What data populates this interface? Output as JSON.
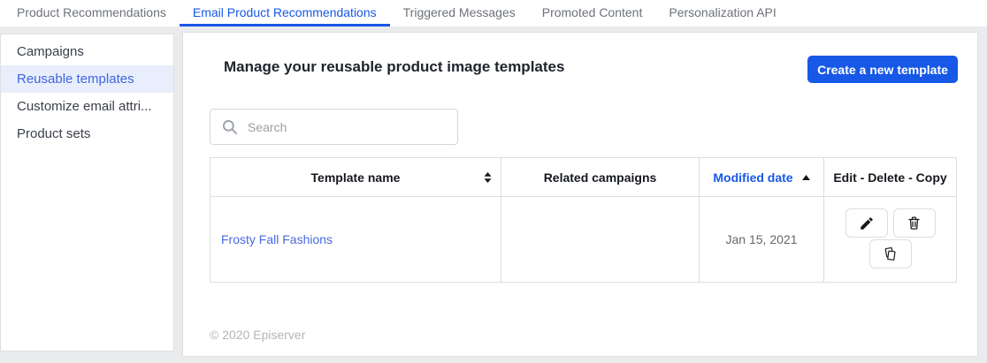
{
  "tabs": {
    "items": [
      {
        "label": "Product Recommendations",
        "active": false
      },
      {
        "label": "Email Product Recommendations",
        "active": true
      },
      {
        "label": "Triggered Messages",
        "active": false
      },
      {
        "label": "Promoted Content",
        "active": false
      },
      {
        "label": "Personalization API",
        "active": false
      }
    ]
  },
  "sidebar": {
    "items": [
      {
        "label": "Campaigns",
        "selected": false
      },
      {
        "label": "Reusable templates",
        "selected": true
      },
      {
        "label": "Customize email attri...",
        "selected": false
      },
      {
        "label": "Product sets",
        "selected": false
      }
    ]
  },
  "main": {
    "heading": "Manage your reusable product image templates",
    "create_button": "Create a new template",
    "search_placeholder": "Search",
    "table": {
      "columns": [
        "Template name",
        "Related campaigns",
        "Modified date",
        "Edit - Delete - Copy"
      ],
      "sorted_column": "Modified date",
      "sort_direction": "ascending",
      "rows": [
        {
          "template_name": "Frosty Fall Fashions",
          "related_campaigns": "",
          "modified_date": "Jan 15, 2021"
        }
      ],
      "actions": {
        "edit": "Edit",
        "delete": "Delete",
        "copy": "Copy"
      }
    },
    "footer": "© 2020 Episerver"
  },
  "icons": {
    "search": "magnifier",
    "sort_both": "up-down-triangles",
    "sort_asc": "up-triangle",
    "edit": "pencil",
    "delete": "trash-can",
    "copy": "overlapping-pages"
  },
  "colors": {
    "accent": "#1758e6",
    "link": "#4a68e1",
    "selected_item_bg": "#e8eefb",
    "background": "#eaebed"
  }
}
